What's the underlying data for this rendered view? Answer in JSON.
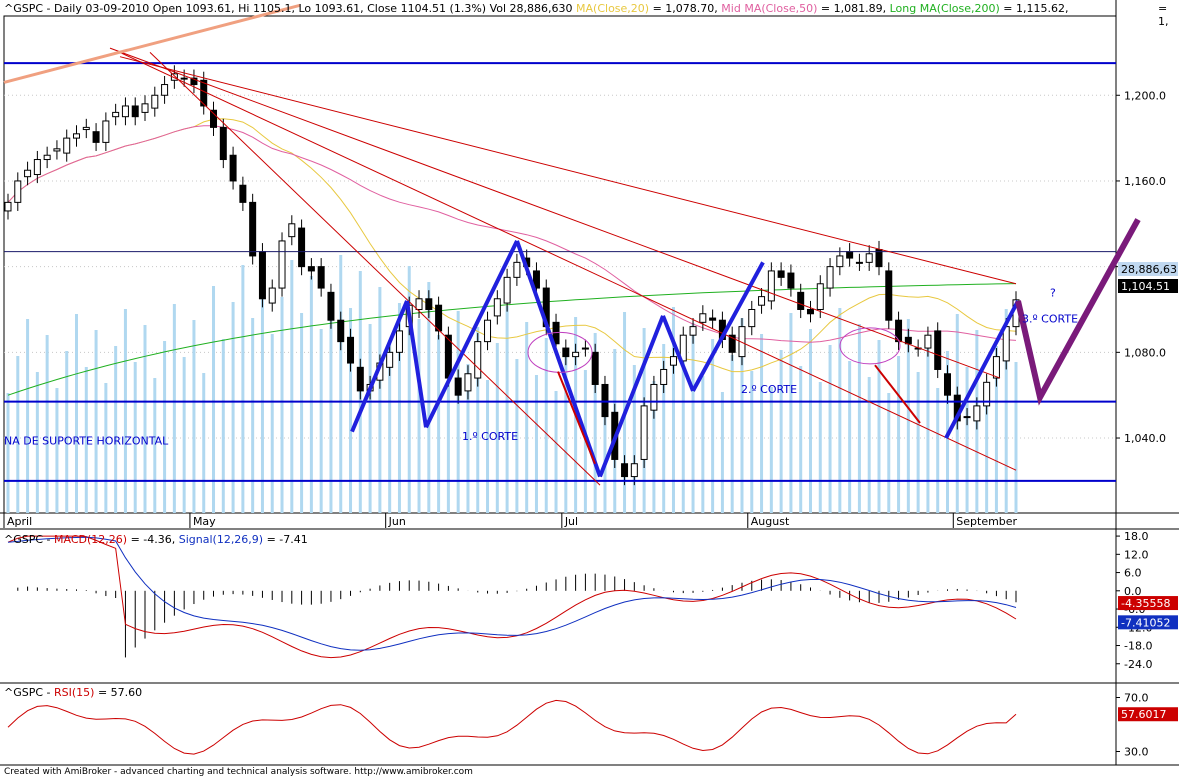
{
  "header": {
    "symbol": "^GSPC - Daily 03-09-2010",
    "open": "Open 1093.61,",
    "hi": "Hi 1105.1,",
    "lo": "Lo 1093.61,",
    "close": "Close 1104.51 (1.3%)",
    "vol": "Vol 28,886,630",
    "ma20_label": "MA(Close,20)",
    "ma20_value": "= 1,078.70,",
    "ma50_label": "Mid MA(Close,50)",
    "ma50_value": "= 1,081.89,",
    "ma200_label": "Long MA(Close,200)",
    "ma200_value": "= 1,115.62,",
    "corner": "= 1,"
  },
  "annotations": {
    "support": "NA DE SUPORTE HORIZONTAL",
    "corte1": "1.º CORTE",
    "corte2": "2.º CORTE",
    "corte3": "3.º CORTE",
    "question": "?"
  },
  "price_badges": {
    "volume": "28,886,63",
    "close": "1,104.51"
  },
  "macd_header": {
    "prefix": "^GSPC -",
    "macd_label": "MACD(12,26)",
    "macd_value": "= -4.36,",
    "signal_label": "Signal(12,26,9)",
    "signal_value": "= -7.41"
  },
  "macd_badges": {
    "macd": "-4.35558",
    "signal": "-7.41052"
  },
  "rsi_header": {
    "prefix": "^GSPC -",
    "rsi_label": "RSI(15)",
    "rsi_value": "= 57.60"
  },
  "rsi_badge": "57.6017",
  "footer": "Created with AmiBroker - advanced charting and technical analysis software. http://www.amibroker.com",
  "colors": {
    "ma20": "#e8c840",
    "ma50": "#e060a0",
    "ma200": "#20b020",
    "trend": "#cc0000",
    "support": "#0000cc",
    "zigzag": "#2020dd",
    "projection": "#7a1a7a",
    "volume": "#b0d8f0",
    "macd": "#cc0000",
    "signal": "#1030c0",
    "rsi": "#cc0000"
  },
  "chart_data": [
    {
      "type": "candlestick",
      "title": "^GSPC - Daily 03-09-2010",
      "x_tick_labels": [
        "April",
        "May",
        "Jun",
        "Jul",
        "August",
        "September"
      ],
      "y_tick_labels": [
        "1,200.0",
        "1,160.0",
        "1,120.0",
        "1,080.0",
        "1,040.0"
      ],
      "ylim": [
        1005,
        1237
      ],
      "days": 97,
      "month_start_index": [
        0,
        19,
        39,
        57,
        76,
        97
      ],
      "closes": [
        1150,
        1160,
        1165,
        1170,
        1172,
        1175,
        1180,
        1182,
        1185,
        1178,
        1188,
        1192,
        1195,
        1190,
        1196,
        1200,
        1205,
        1210,
        1208,
        1205,
        1195,
        1185,
        1170,
        1160,
        1150,
        1125,
        1105,
        1110,
        1132,
        1140,
        1120,
        1118,
        1110,
        1095,
        1085,
        1075,
        1062,
        1065,
        1075,
        1080,
        1090,
        1102,
        1105,
        1100,
        1090,
        1068,
        1060,
        1070,
        1085,
        1095,
        1105,
        1115,
        1122,
        1120,
        1110,
        1092,
        1084,
        1078,
        1080,
        1082,
        1065,
        1050,
        1030,
        1022,
        1028,
        1055,
        1065,
        1072,
        1078,
        1088,
        1092,
        1098,
        1095,
        1086,
        1080,
        1092,
        1100,
        1106,
        1118,
        1115,
        1110,
        1100,
        1098,
        1112,
        1120,
        1125,
        1124,
        1122,
        1126,
        1120,
        1095,
        1085,
        1084,
        1082,
        1088,
        1072,
        1060,
        1048,
        1050,
        1055,
        1066,
        1078,
        1092,
        1104.51
      ],
      "series": [
        {
          "name": "MA(Close,20)",
          "value": 1078.7
        },
        {
          "name": "Mid MA(Close,50)",
          "value": 1081.89
        },
        {
          "name": "Long MA(Close,200)",
          "value": 1115.62
        }
      ]
    },
    {
      "type": "line",
      "title": "^GSPC - MACD(12,26)",
      "y_tick_labels": [
        "18.0",
        "12.0",
        "6.0",
        "0.0",
        "-6.0",
        "-12.0",
        "-18.0",
        "-24.0"
      ],
      "ylim": [
        -30,
        20
      ],
      "series": [
        {
          "name": "MACD(12,26)",
          "value": -4.36
        },
        {
          "name": "Signal(12,26,9)",
          "value": -7.41
        }
      ]
    },
    {
      "type": "line",
      "title": "^GSPC - RSI(15)",
      "y_tick_labels": [
        "70.0",
        "30.0"
      ],
      "ylim": [
        20,
        80
      ],
      "series": [
        {
          "name": "RSI(15)",
          "value": 57.6
        }
      ]
    }
  ]
}
